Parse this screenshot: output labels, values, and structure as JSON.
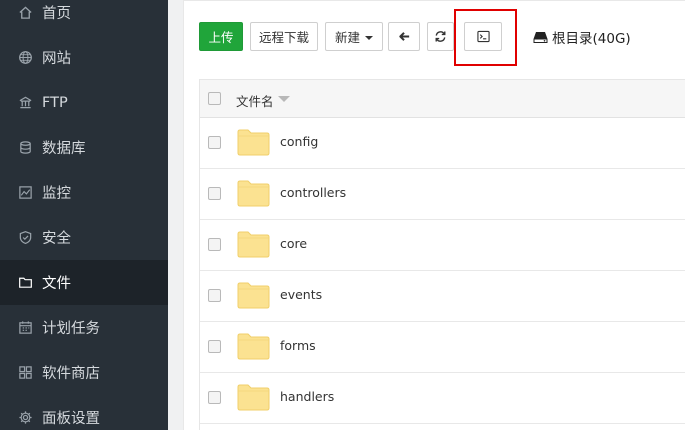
{
  "sidebar": {
    "items": [
      {
        "label": "首页",
        "icon": "home-icon"
      },
      {
        "label": "网站",
        "icon": "globe-icon"
      },
      {
        "label": "FTP",
        "icon": "ftp-icon"
      },
      {
        "label": "数据库",
        "icon": "database-icon"
      },
      {
        "label": "监控",
        "icon": "monitor-icon"
      },
      {
        "label": "安全",
        "icon": "shield-icon"
      },
      {
        "label": "文件",
        "icon": "folder-icon",
        "active": true
      },
      {
        "label": "计划任务",
        "icon": "calendar-icon"
      },
      {
        "label": "软件商店",
        "icon": "grid-icon"
      },
      {
        "label": "面板设置",
        "icon": "gear-icon"
      }
    ]
  },
  "toolbar": {
    "upload_label": "上传",
    "remote_download_label": "远程下载",
    "new_label": "新建",
    "back_icon": "arrow-left-icon",
    "refresh_icon": "refresh-icon",
    "terminal_icon": "terminal-icon",
    "disk_label": "根目录(40G)",
    "disk_icon": "hdd-icon"
  },
  "table": {
    "header": {
      "name_label": "文件名"
    },
    "rows": [
      {
        "name": "config"
      },
      {
        "name": "controllers"
      },
      {
        "name": "core"
      },
      {
        "name": "events"
      },
      {
        "name": "forms"
      },
      {
        "name": "handlers"
      }
    ]
  },
  "colors": {
    "sidebar_bg": "#283038",
    "sidebar_active_bg": "#1d2329",
    "primary": "#20a53a",
    "folder": "#fbe291",
    "highlight": "#e00000"
  }
}
